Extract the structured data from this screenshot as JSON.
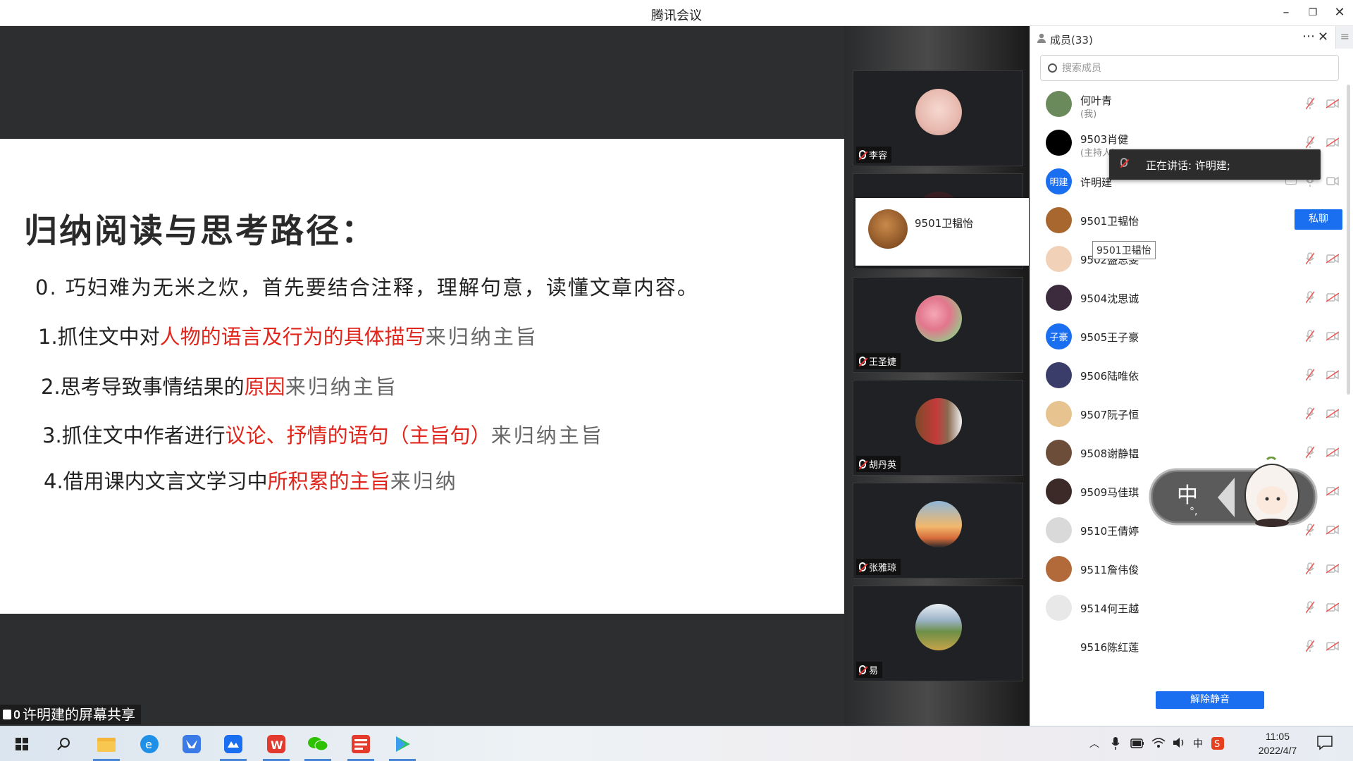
{
  "window": {
    "title": "腾讯会议"
  },
  "slide": {
    "title": "归纳阅读与思考路径：",
    "line0": "0. 巧妇难为无米之炊，首先要结合注释，理解句意，读懂文章内容。",
    "line1": {
      "a": "1.抓住文中对",
      "b": "人物的语言及行为的具体描写",
      "c": "来归纳主旨"
    },
    "line2": {
      "a": "2.思考导致事情结果的",
      "b": "原因",
      "c": "来归纳主旨"
    },
    "line3": {
      "a": "3.抓住文中作者进行",
      "b": "议论、抒情的语句（主旨句）",
      "c": "来归纳主旨"
    },
    "line4": {
      "a": "4.借用课内文言文学习中",
      "b": "所积累的主旨",
      "c": "来归纳"
    }
  },
  "share_label": "许明建的屏幕共享",
  "video_tiles": [
    {
      "name": "李容",
      "icon": "avatar-photo"
    },
    {
      "name": "",
      "icon": "avatar-photo"
    },
    {
      "name": "王圣婕",
      "icon": "avatar-roses"
    },
    {
      "name": "胡丹英",
      "icon": "avatar-photo"
    },
    {
      "name": "张雅琼",
      "icon": "avatar-sunset"
    },
    {
      "name": "易",
      "icon": "avatar-landscape"
    }
  ],
  "hover_card": {
    "name": "9501卫韫怡"
  },
  "panel": {
    "title": "成员(33)",
    "search_placeholder": "搜索成员",
    "members": [
      {
        "name": "何叶青",
        "sub": "(我)",
        "avatar_text": "",
        "avatar_color": "#6a8a5c"
      },
      {
        "name": "9503肖健",
        "sub": "(主持人)",
        "avatar_text": "",
        "avatar_color": "#000000"
      },
      {
        "name": "许明建",
        "sub": "",
        "avatar_text": "明建",
        "avatar_color": "#1a6ef0"
      },
      {
        "name": "9501卫韫怡",
        "sub": "",
        "avatar_text": "",
        "avatar_color": "#a8672f"
      },
      {
        "name": "9502盛思雯",
        "sub": "",
        "avatar_text": "",
        "avatar_color": "#f1d2b8"
      },
      {
        "name": "9504沈思诚",
        "sub": "",
        "avatar_text": "",
        "avatar_color": "#3b2b3c"
      },
      {
        "name": "9505王子豪",
        "sub": "",
        "avatar_text": "子豪",
        "avatar_color": "#1a6ef0"
      },
      {
        "name": "9506陆唯依",
        "sub": "",
        "avatar_text": "",
        "avatar_color": "#3a3d6a"
      },
      {
        "name": "9507阮子恒",
        "sub": "",
        "avatar_text": "",
        "avatar_color": "#e6c38f"
      },
      {
        "name": "9508谢静韫",
        "sub": "",
        "avatar_text": "",
        "avatar_color": "#6b4d3a"
      },
      {
        "name": "9509马佳琪",
        "sub": "",
        "avatar_text": "",
        "avatar_color": "#3c2a28"
      },
      {
        "name": "9510王倩婷",
        "sub": "",
        "avatar_text": "",
        "avatar_color": "#d9d9d9"
      },
      {
        "name": "9511詹伟俊",
        "sub": "",
        "avatar_text": "",
        "avatar_color": "#b36a3a"
      },
      {
        "name": "9514何王越",
        "sub": "",
        "avatar_text": "",
        "avatar_color": "#e8e8e8"
      },
      {
        "name": "9516陈红莲",
        "sub": "",
        "avatar_text": "",
        "avatar_color": "#ffffff"
      }
    ],
    "private_chat_label": "私聊",
    "tooltip": "9501卫韫怡",
    "speaking": "正在讲话: 许明建;",
    "unmute_label": "解除静音"
  },
  "ime": {
    "label": "中",
    "mark": "°,"
  },
  "taskbar": {
    "time": "11:05",
    "date": "2022/4/7",
    "lang": "中"
  },
  "colors": {
    "accent": "#1a6ef0",
    "highlight_red": "#e0261c"
  }
}
